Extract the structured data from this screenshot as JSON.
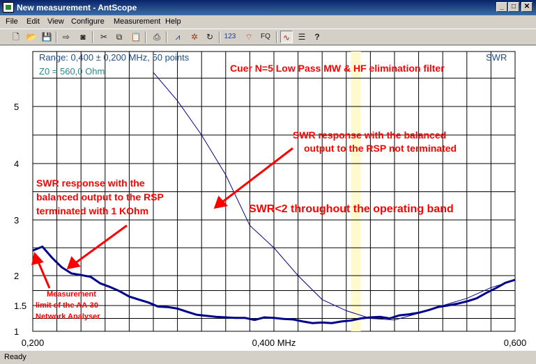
{
  "window": {
    "title": "New measurement - AntScope",
    "minimize": "_",
    "maximize": "□",
    "close": "✕"
  },
  "menu": [
    "File",
    "Edit",
    "View",
    "Configure",
    "Measurement",
    "Help"
  ],
  "toolbar": {
    "new": "new-file-icon",
    "open": "open-folder-icon",
    "save": "save-icon",
    "export": "export-icon",
    "camera": "camera-icon",
    "cut": "cut-icon",
    "copy": "copy-icon",
    "paste": "paste-icon",
    "print": "print-icon",
    "chart": "chart-icon",
    "settings": "settings-icon",
    "refresh": "refresh-icon",
    "numeric_label": "123",
    "wireless": "wireless-icon",
    "fq_label": "FQ",
    "smith": "smith-chart-icon",
    "list": "list-icon",
    "help": "help-icon"
  },
  "status": {
    "text": "Ready"
  },
  "chart_data": {
    "type": "line",
    "info": {
      "range": "Range: 0,400 ± 0,200 MHz, 50 points",
      "z0": "Z0 = 560,0 Ohm",
      "trace_label": "SWR"
    },
    "x_ticks": [
      "0,200",
      "0,400 MHz",
      "0,600"
    ],
    "xlim": [
      0.2,
      0.6
    ],
    "y_ticks": [
      "1",
      "1.5",
      "2",
      "3",
      "4",
      "5"
    ],
    "ylim": [
      1,
      5.65
    ],
    "y_scale": "1 + log-like (non-linear) as drawn",
    "grid": true,
    "operating_marker_mhz": 0.468,
    "colors": {
      "trace": "#00008b",
      "annotation": "#ff0000",
      "info": "#1f4e8c",
      "marker": "#fffacd"
    },
    "series": [
      {
        "x": [
          0.2,
          0.208,
          0.216,
          0.224,
          0.232,
          0.24,
          0.248,
          0.256,
          0.264,
          0.272,
          0.28,
          0.288,
          0.296,
          0.304,
          0.312,
          0.32,
          0.328,
          0.336,
          0.344,
          0.352,
          0.36,
          0.368,
          0.376,
          0.384,
          0.392,
          0.4,
          0.408,
          0.416,
          0.424,
          0.432,
          0.44,
          0.448,
          0.456,
          0.464,
          0.472,
          0.48,
          0.488,
          0.496,
          0.504,
          0.512,
          0.52,
          0.528,
          0.536,
          0.544,
          0.552,
          0.56,
          0.568,
          0.576,
          0.584,
          0.592,
          0.6
        ],
        "values": [
          2.45,
          2.52,
          2.32,
          2.15,
          2.04,
          2.01,
          1.98,
          1.87,
          1.81,
          1.74,
          1.65,
          1.6,
          1.55,
          1.48,
          1.47,
          1.44,
          1.38,
          1.32,
          1.3,
          1.28,
          1.27,
          1.26,
          1.26,
          1.22,
          1.27,
          1.26,
          1.24,
          1.23,
          1.19,
          1.16,
          1.17,
          1.16,
          1.19,
          1.21,
          1.25,
          1.27,
          1.28,
          1.25,
          1.31,
          1.33,
          1.36,
          1.41,
          1.47,
          1.5,
          1.53,
          1.57,
          1.62,
          1.71,
          1.79,
          1.88,
          1.93
        ]
      },
      {
        "x": [
          0.3,
          0.32,
          0.34,
          0.36,
          0.38,
          0.4,
          0.42,
          0.44,
          0.46,
          0.48,
          0.5,
          0.52,
          0.54,
          0.56,
          0.58,
          0.6
        ],
        "values": [
          5.6,
          5.1,
          4.5,
          3.8,
          2.9,
          2.5,
          2.0,
          1.6,
          1.4,
          1.25,
          1.22,
          1.35,
          1.5,
          1.62,
          1.8,
          1.92
        ]
      }
    ],
    "annotations": [
      "Cuer N=5 Low Pass MW & HF elimination filter",
      "SWR response with the balanced",
      "output to the RSP not terminated",
      "SWR response with the",
      "balanced output to the RSP",
      "terminated with 1 KOhm",
      "SWR<2 throughout the operating band",
      "Measurement",
      "limit of the AA-30",
      "Network Analyser"
    ]
  }
}
